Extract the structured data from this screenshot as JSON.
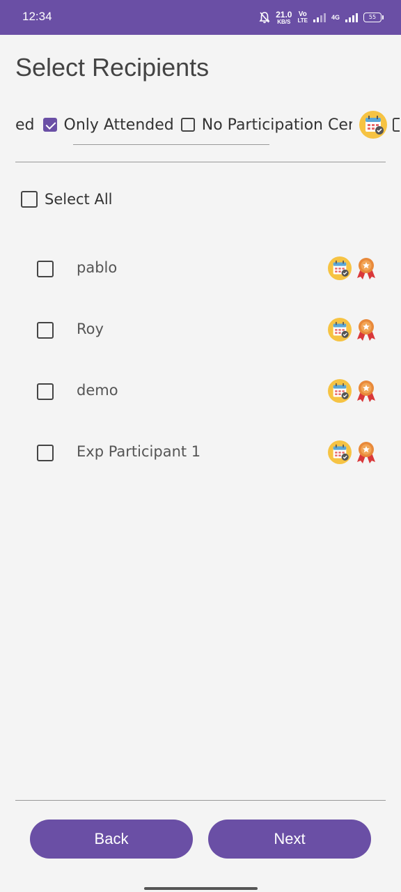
{
  "status_bar": {
    "time": "12:34",
    "speed_value": "21.0",
    "speed_unit": "KB/S",
    "volte_top": "Vo",
    "volte_bottom": "LTE",
    "network": "4G",
    "battery": "55"
  },
  "page": {
    "title": "Select Recipients"
  },
  "filters": {
    "partial_left": "ed",
    "items": [
      {
        "label": "Only Attended",
        "checked": true
      },
      {
        "label": "No Participation Cert",
        "checked": false
      }
    ]
  },
  "select_all": {
    "label": "Select All",
    "checked": false
  },
  "recipients": [
    {
      "name": "pablo",
      "checked": false
    },
    {
      "name": "Roy",
      "checked": false
    },
    {
      "name": "demo",
      "checked": false
    },
    {
      "name": "Exp Participant 1",
      "checked": false
    }
  ],
  "icons": {
    "attendance": "calendar-check-icon",
    "certificate": "award-ribbon-icon"
  },
  "actions": {
    "back_label": "Back",
    "next_label": "Next"
  },
  "colors": {
    "accent": "#6a4fa5",
    "background": "#f4f4f4",
    "calendar_bg": "#f6c343",
    "award": "#e8893a"
  }
}
